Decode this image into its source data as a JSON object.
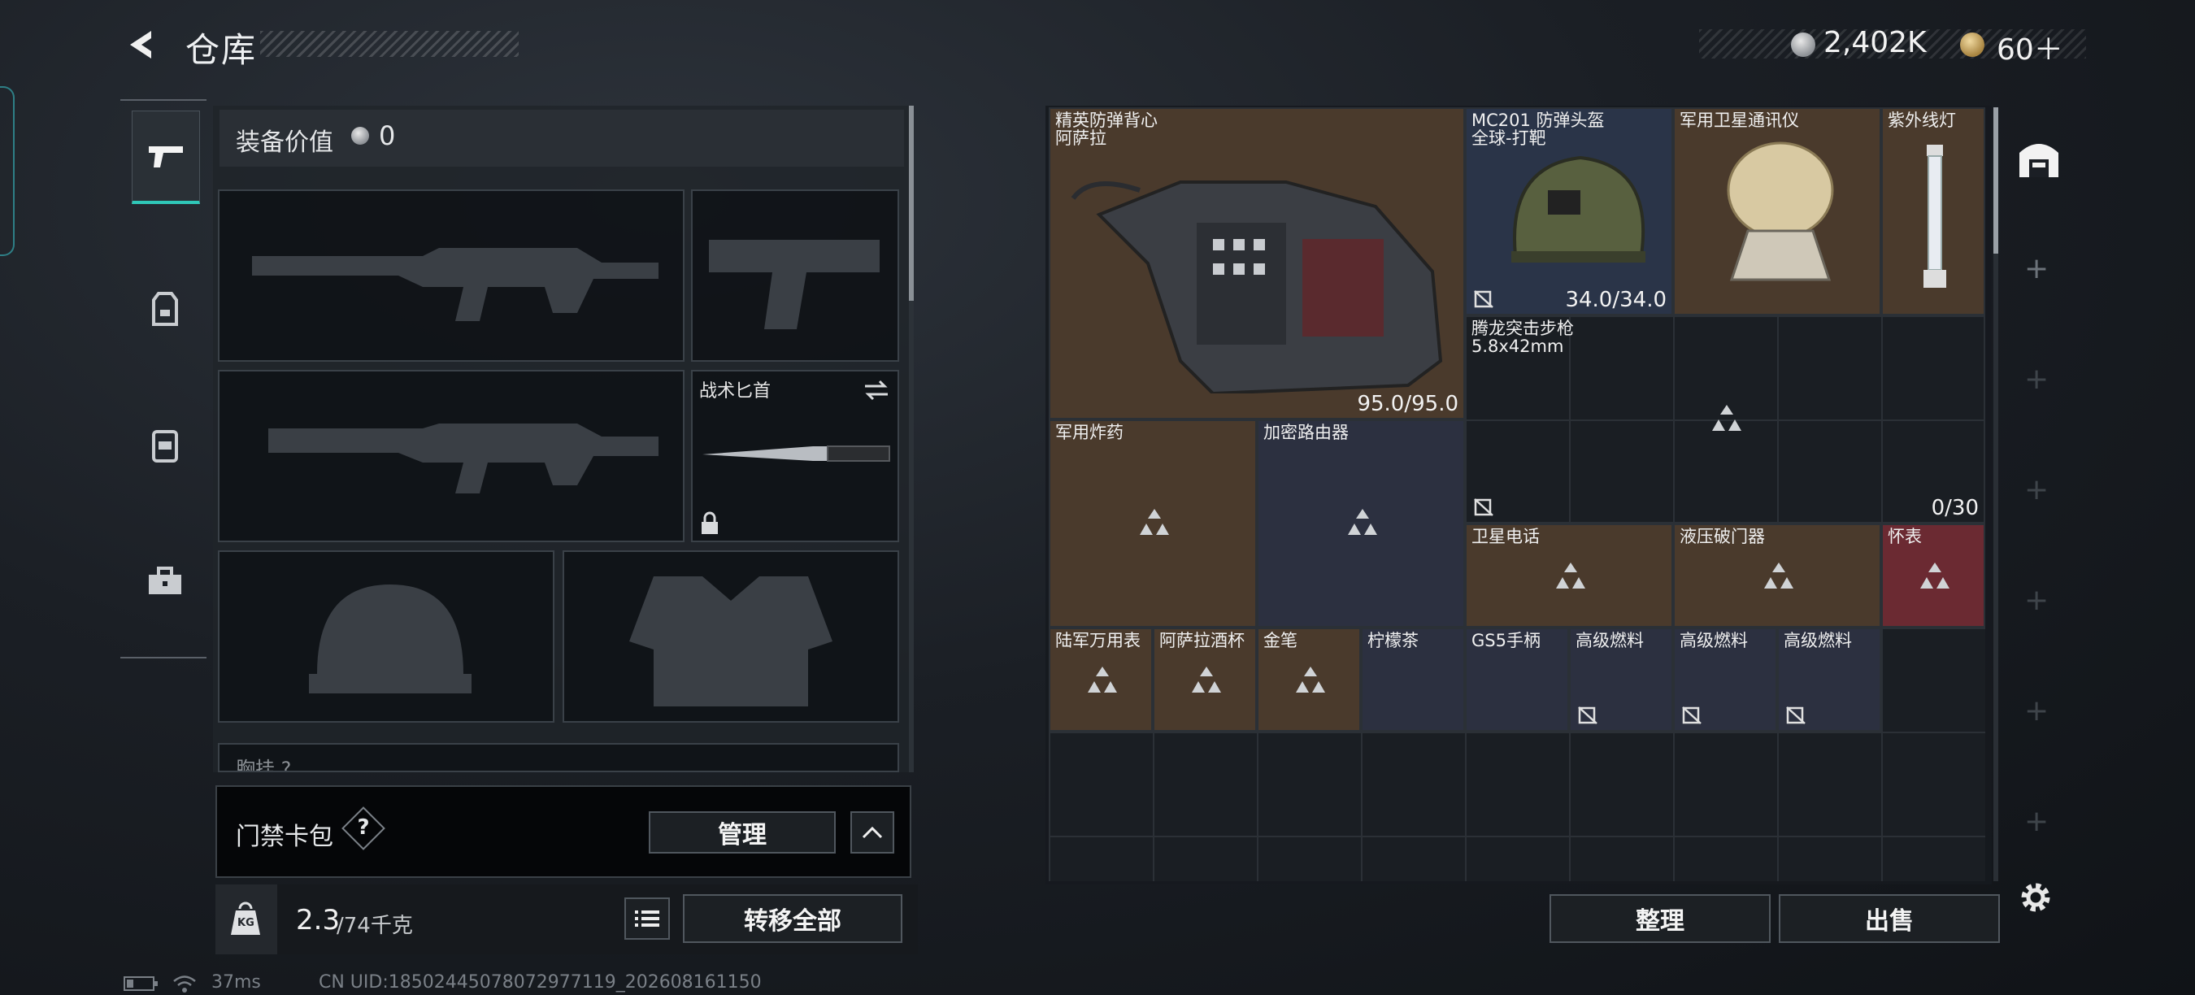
{
  "header": {
    "title": "仓库",
    "silver": "2,402K",
    "gold": "60＋"
  },
  "equipment": {
    "value_label": "装备价值",
    "value": "0",
    "knife_label": "战术匕首",
    "chest_label_partial": "胸挂 ?"
  },
  "keycard": {
    "label": "门禁卡包",
    "help": "?",
    "manage_label": "管理"
  },
  "weight": {
    "current": "2.3",
    "max": "/74千克",
    "icon_label": "KG",
    "transfer_label": "转移全部"
  },
  "grid_items": {
    "vest": {
      "name": "精英防弹背心",
      "sub": "阿萨拉",
      "durability": "95.0/95.0"
    },
    "helmet": {
      "name": "MC201 防弹头盔",
      "sub": "全球-打靶",
      "durability": "34.0/34.0"
    },
    "satcom": {
      "name": "军用卫星通讯仪"
    },
    "uvlamp": {
      "name": "紫外线灯"
    },
    "rifle": {
      "name": "腾龙突击步枪",
      "sub": "5.8x42mm",
      "ammo": "0/30"
    },
    "explosive": {
      "name": "军用炸药"
    },
    "router": {
      "name": "加密路由器"
    },
    "satphone": {
      "name": "卫星电话"
    },
    "breacher": {
      "name": "液压破门器"
    },
    "pocketwatch": {
      "name": "怀表"
    },
    "armywatch": {
      "name": "陆军万用表"
    },
    "cup": {
      "name": "阿萨拉酒杯"
    },
    "pen": {
      "name": "金笔"
    },
    "tea": {
      "name": "柠檬茶"
    },
    "grip": {
      "name": "GS5手柄"
    },
    "fuel1": {
      "name": "高级燃料"
    },
    "fuel2": {
      "name": "高级燃料"
    },
    "fuel3": {
      "name": "高级燃料"
    }
  },
  "actions": {
    "sort_label": "整理",
    "sell_label": "出售"
  },
  "status": {
    "ping": "37ms",
    "uid": "CN UID:18502445078072977119_202608161150"
  }
}
